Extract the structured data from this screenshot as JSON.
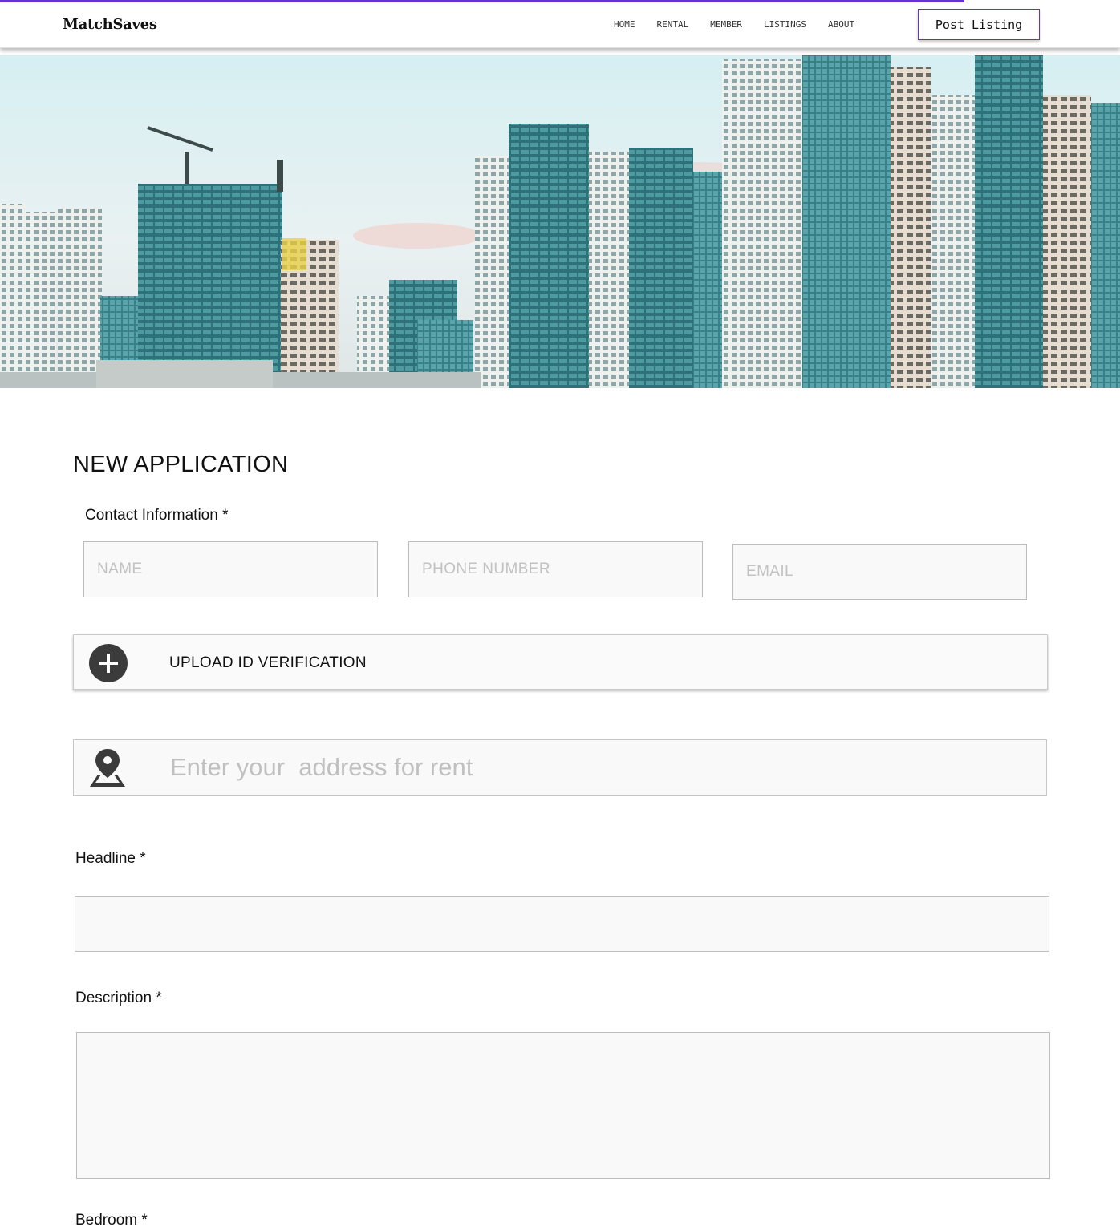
{
  "header": {
    "brand": "MatchSaves",
    "nav": [
      "HOME",
      "RENTAL",
      "MEMBER",
      "LISTINGS",
      "ABOUT"
    ],
    "post_button": "Post Listing"
  },
  "colors": {
    "accent": "#6a2ed1",
    "icon_dark": "#3b3b3b",
    "field_bg": "#f9f9f9",
    "placeholder": "#c2c2c2"
  },
  "form": {
    "title": "NEW APPLICATION",
    "contact_label": "Contact Information *",
    "name_placeholder": "NAME",
    "phone_placeholder": "PHONE NUMBER",
    "email_placeholder": "EMAIL",
    "upload_label": "UPLOAD ID VERIFICATION",
    "address_placeholder": "Enter your  address for rent",
    "headline_label": "Headline *",
    "headline_value": "",
    "description_label": "Description *",
    "description_value": "",
    "bedroom_label": "Bedroom *"
  },
  "icons": {
    "upload": "plus-circle-icon",
    "address": "map-pin-icon"
  }
}
